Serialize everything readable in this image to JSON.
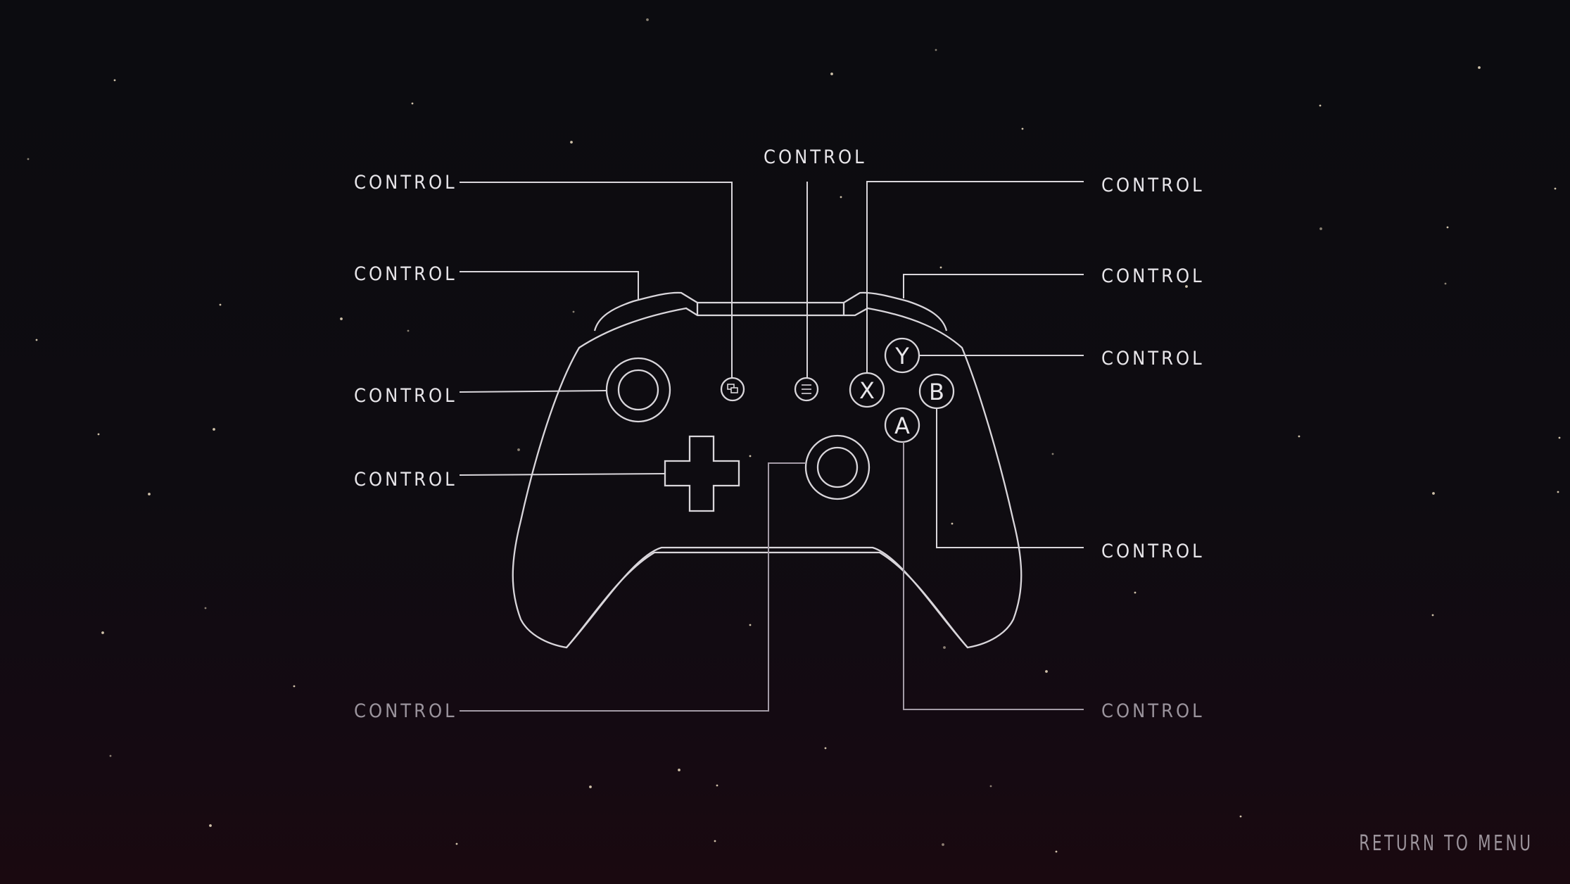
{
  "screen": "controls",
  "colors": {
    "background_top": "#0c0c10",
    "background_bottom": "#1a0910",
    "line": "#d9d6db",
    "line_dim": "#a39ba6",
    "star": "#f1e2c4"
  },
  "labels": {
    "top_center": "CONTROL",
    "left_view_button": "CONTROL",
    "left_bumper": "CONTROL",
    "left_stick": "CONTROL",
    "dpad": "CONTROL",
    "right_stick": "CONTROL",
    "right_x_button": "CONTROL",
    "right_bumper": "CONTROL",
    "right_y_button": "CONTROL",
    "right_b_button": "CONTROL",
    "right_a_button": "CONTROL"
  },
  "face_buttons": {
    "y": "Y",
    "x": "X",
    "b": "B",
    "a": "A"
  },
  "icons": {
    "view_button": "view-icon",
    "menu_button": "menu-icon"
  },
  "footer": {
    "return_label": "RETURN TO MENU"
  }
}
